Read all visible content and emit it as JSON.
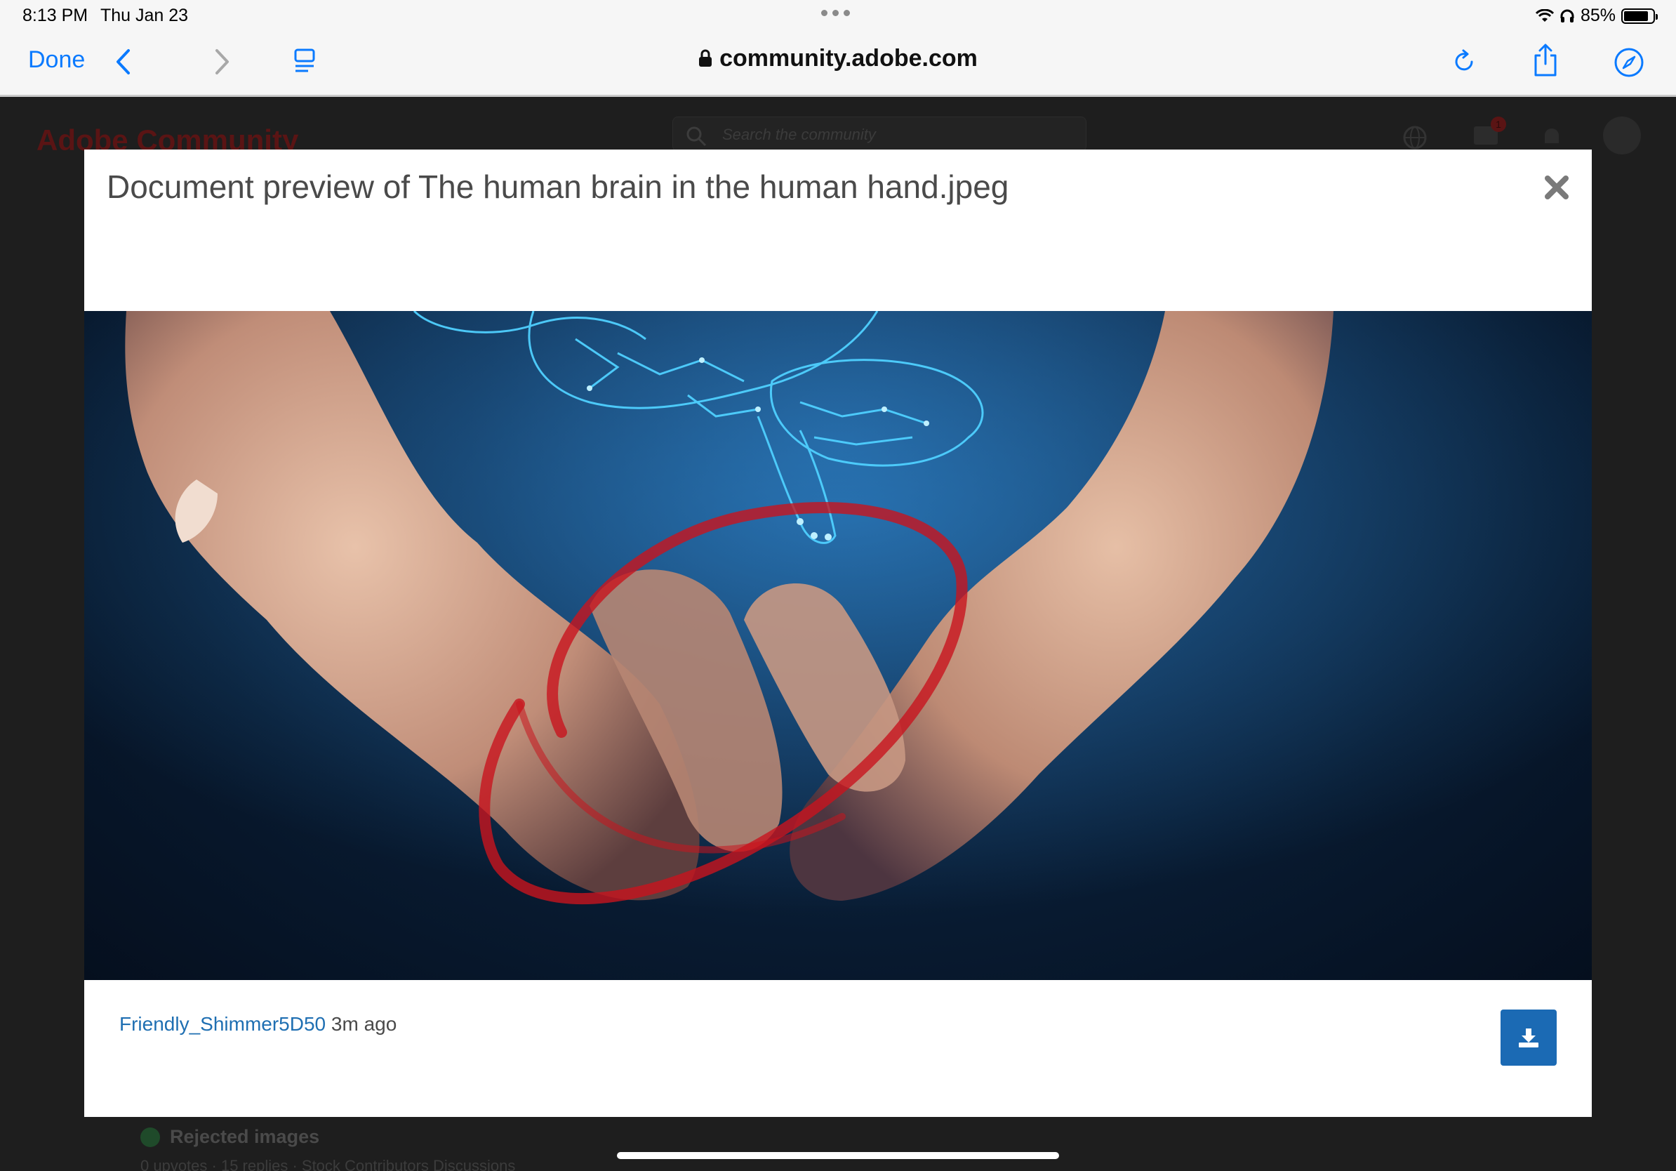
{
  "status_bar": {
    "time": "8:13 PM",
    "date": "Thu Jan 23",
    "battery": "85%",
    "battery_level": 0.85
  },
  "browser": {
    "done_label": "Done",
    "url": "community.adobe.com",
    "icons": [
      "chevron-left-icon",
      "chevron-right-icon",
      "reader-icon",
      "lock-icon",
      "reload-icon",
      "share-icon",
      "compass-icon"
    ]
  },
  "background_page": {
    "logo": "Adobe Community",
    "search_placeholder": "Search the community",
    "notification_count": "1",
    "list_item_title": "Rejected images",
    "list_item_meta": "0 upvotes · 15 replies · Stock Contributors Discussions"
  },
  "modal": {
    "title": "Document preview of The human brain in the human hand.jpeg",
    "author": "Friendly_Shimmer5D50",
    "time_ago": "3m ago",
    "accent_color": "#1b6ab4"
  }
}
